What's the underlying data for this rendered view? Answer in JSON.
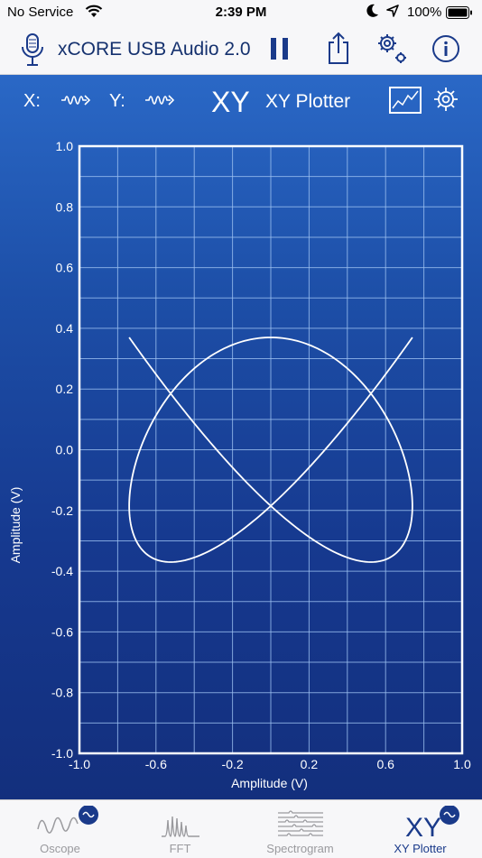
{
  "status_bar": {
    "carrier": "No Service",
    "time": "2:39 PM",
    "battery": "100%"
  },
  "toolbar": {
    "device_name": "xCORE USB Audio 2.0"
  },
  "controls": {
    "x_label": "X:",
    "y_label": "Y:",
    "mode": "XY",
    "title": "XY Plotter"
  },
  "chart_data": {
    "type": "line",
    "xlabel": "Amplitude (V)",
    "ylabel": "Amplitude (V)",
    "xlim": [
      -1.0,
      1.0
    ],
    "ylim": [
      -1.0,
      1.0
    ],
    "grid": true,
    "x_ticks": [
      "-1.0",
      "-0.6",
      "-0.2",
      "0.2",
      "0.6",
      "1.0"
    ],
    "y_ticks": [
      "1.0",
      "0.8",
      "0.6",
      "0.4",
      "0.2",
      "0.0",
      "-0.2",
      "-0.4",
      "-0.6",
      "-0.8",
      "-1.0"
    ],
    "curve": {
      "x_amplitude": 0.74,
      "x_frequency": 3,
      "y_amplitude": 0.37,
      "y_frequency": 4
    },
    "colors": {
      "curve": "#ffffff",
      "grid": "#9cc0f0",
      "frame": "#ffffff"
    }
  },
  "tabs": [
    {
      "label": "Oscope",
      "icon": "oscope-icon",
      "active": false
    },
    {
      "label": "FFT",
      "icon": "fft-icon",
      "active": false
    },
    {
      "label": "Spectrogram",
      "icon": "spectrogram-icon",
      "active": false
    },
    {
      "label": "XY Plotter",
      "icon": "xy-plotter-icon",
      "active": true
    }
  ],
  "colors": {
    "accent": "#1a3a8a",
    "background_top": "#2a68c6",
    "background_bottom": "#132f7d"
  }
}
